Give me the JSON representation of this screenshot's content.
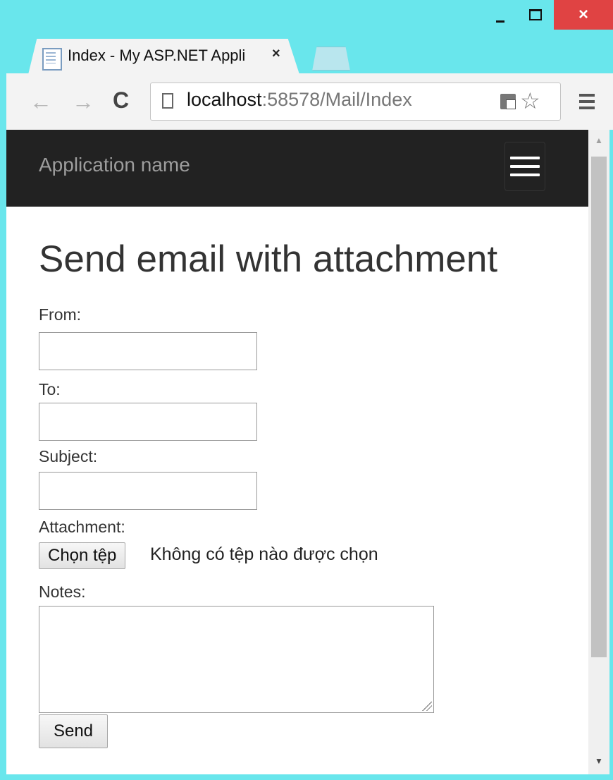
{
  "browser": {
    "tab_title": "Index - My ASP.NET Appli",
    "tab_close": "×",
    "url_host": "localhost",
    "url_rest": ":58578/Mail/Index",
    "back_glyph": "←",
    "forward_glyph": "→",
    "reload_glyph": "C",
    "star_glyph": "☆",
    "close_glyph": "×"
  },
  "navbar": {
    "brand": "Application name"
  },
  "form": {
    "heading": "Send email with attachment",
    "from_label": "From:",
    "to_label": "To:",
    "subject_label": "Subject:",
    "attachment_label": "Attachment:",
    "file_button": "Chọn tệp",
    "file_status": "Không có tệp nào được chọn",
    "notes_label": "Notes:",
    "send_button": "Send",
    "from_value": "",
    "to_value": "",
    "subject_value": "",
    "notes_value": ""
  },
  "colors": {
    "window_frame": "#69e6ec",
    "navbar_bg": "#222222",
    "close_button": "#e04343"
  }
}
